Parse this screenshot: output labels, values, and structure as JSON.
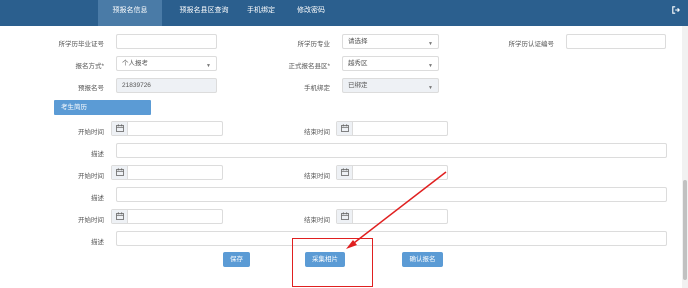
{
  "nav": {
    "tabs": [
      {
        "label": "预报名信息"
      },
      {
        "label": "预报名县区查询"
      },
      {
        "label": "手机绑定"
      },
      {
        "label": "修改密码"
      }
    ]
  },
  "form": {
    "grad_cert_no_label": "所学历毕业证号",
    "grad_cert_no_value": "",
    "major_label": "所学历专业",
    "major_value": "请选择",
    "degree_cert_no_label": "所学历认证编号",
    "degree_cert_no_value": "",
    "reg_method_label": "报名方式*",
    "reg_method_value": "个人报考",
    "formal_district_label": "正式报名县区*",
    "formal_district_value": "越秀区",
    "prereg_no_label": "预报名号",
    "prereg_no_value": "21839726",
    "phone_bind_label": "手机绑定",
    "phone_bind_value": "已绑定"
  },
  "resume": {
    "section_title": "考生简历",
    "start_label": "开始时间",
    "end_label": "结束时间",
    "desc_label": "描述",
    "entries": [
      {
        "start": "",
        "end": "",
        "desc": ""
      },
      {
        "start": "",
        "end": "",
        "desc": ""
      },
      {
        "start": "",
        "end": "",
        "desc": ""
      }
    ]
  },
  "actions": {
    "save_label": "保存",
    "capture_photo_label": "采集相片",
    "confirm_label": "确认报名"
  },
  "colors": {
    "topbar": "#2b5f8e",
    "active_tab": "#4a7ba7",
    "button": "#5b9bd5",
    "annotation": "#e02020"
  }
}
